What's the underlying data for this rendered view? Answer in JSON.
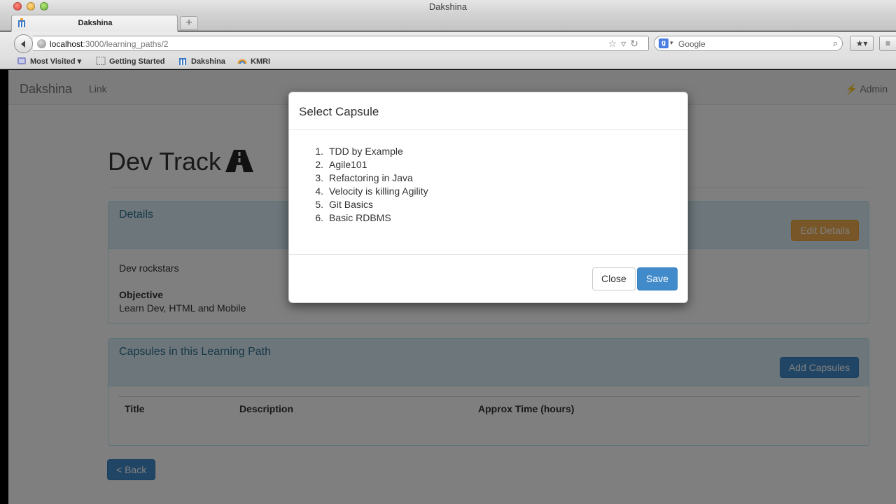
{
  "window": {
    "title": "Dakshina"
  },
  "tab": {
    "label": "Dakshina",
    "newtab_label": "+"
  },
  "urlbar": {
    "host": "localhost",
    "path": ":3000/learning_paths/2"
  },
  "search": {
    "placeholder": "Google"
  },
  "bookmarks": [
    {
      "label": "Most Visited",
      "icon": "most-visited-icon",
      "has_dropdown": true
    },
    {
      "label": "Getting Started",
      "icon": "page-icon"
    },
    {
      "label": "Dakshina",
      "icon": "dakshina-favicon"
    },
    {
      "label": "KMRI",
      "icon": "kmri-icon"
    }
  ],
  "app_nav": {
    "brand": "Dakshina",
    "link": "Link",
    "admin": "Admin"
  },
  "page": {
    "title": "Dev Track"
  },
  "details_panel": {
    "title": "Details",
    "edit_button": "Edit Details",
    "description": "Dev rockstars",
    "objective_label": "Objective",
    "objective_value": "Learn Dev, HTML and Mobile"
  },
  "capsules_panel": {
    "title": "Capsules in this Learning Path",
    "add_button": "Add Capsules",
    "columns": [
      "Title",
      "Description",
      "Approx Time (hours)"
    ]
  },
  "back_button": "< Back",
  "modal": {
    "title": "Select Capsule",
    "capsules": [
      "TDD by Example",
      "Agile101",
      "Refactoring in Java",
      "Velocity is killing Agility",
      "Git Basics",
      "Basic RDBMS"
    ],
    "close_button": "Close",
    "save_button": "Save"
  },
  "colors": {
    "info_panel_bg": "#d9edf7",
    "info_panel_text": "#31708f",
    "warning": "#f0ad4e",
    "primary": "#428bca"
  }
}
